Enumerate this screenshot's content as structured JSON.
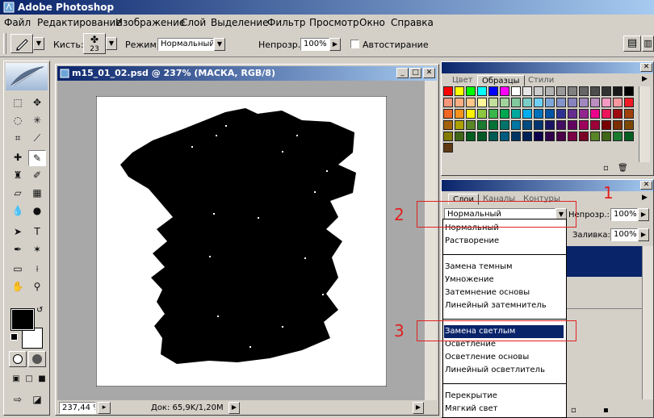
{
  "app": {
    "title": "Adobe Photoshop"
  },
  "menu": [
    "Файл",
    "Редактирование",
    "Изображение",
    "Слой",
    "Выделение",
    "Фильтр",
    "Просмотр",
    "Окно",
    "Справка"
  ],
  "options": {
    "brush_label": "Кисть:",
    "brush_size": "23",
    "mode_label": "Режим:",
    "mode_value": "Нормальный",
    "opacity_label": "Непрозр.:",
    "opacity_value": "100%",
    "autoerase_label": "Автостирание"
  },
  "document": {
    "title": "m15_01_02.psd @ 237% (МАСКА, RGB/8)",
    "zoom": "237,44 %",
    "doc_info": "Док: 65,9K/1,20M"
  },
  "swatches_panel": {
    "tabs": [
      "Цвет",
      "Образцы",
      "Стили"
    ],
    "active_tab": "Образцы",
    "rows": [
      [
        "#ff0000",
        "#ffff00",
        "#00ff00",
        "#00ffff",
        "#0000ff",
        "#ff00ff",
        "#ffffff",
        "#e6e6e6",
        "#cccccc",
        "#b3b3b3",
        "#999999",
        "#808080",
        "#666666",
        "#4d4d4d",
        "#333333",
        "#1a1a1a",
        "#000000"
      ],
      [
        "#f7977a",
        "#f9ad81",
        "#fdc68a",
        "#fff79a",
        "#c4df9b",
        "#a2d39c",
        "#82ca9d",
        "#7bcdc8",
        "#6ecff6",
        "#7ea7d8",
        "#8493ca",
        "#8882be",
        "#a187be",
        "#bc8dbf",
        "#f49ac2",
        "#f6989d",
        "#ed1c24"
      ],
      [
        "#f26522",
        "#f7941d",
        "#fff200",
        "#8dc63f",
        "#39b54a",
        "#00a651",
        "#00a99d",
        "#00aeef",
        "#0072bc",
        "#0054a6",
        "#2e3192",
        "#662d91",
        "#92278f",
        "#ec008c",
        "#ed145b",
        "#9e0b0f",
        "#a0410d"
      ],
      [
        "#a36209",
        "#aba000",
        "#598527",
        "#1a7b30",
        "#007236",
        "#00746b",
        "#0076a3",
        "#004b80",
        "#003471",
        "#1b1464",
        "#440e62",
        "#630460",
        "#9e005d",
        "#9e0039",
        "#790000",
        "#7b2e00",
        "#7d4900"
      ],
      [
        "#827b00",
        "#406618",
        "#005e20",
        "#005826",
        "#005952",
        "#005b7f",
        "#003663",
        "#002157",
        "#0d004c",
        "#32004b",
        "#4b0049",
        "#7b0046",
        "#7a0026",
        "#598527",
        "#406618",
        "#1a7b30",
        "#005e20"
      ],
      [
        "#603913"
      ]
    ]
  },
  "layers_panel": {
    "tabs": [
      "Слои",
      "Каналы",
      "Контуры"
    ],
    "active_tab": "Слои",
    "blend_mode": "Нормальный",
    "opacity_label": "Непрозр.:",
    "opacity_value": "100%",
    "fill_label": "Заливка:",
    "fill_value": "100%"
  },
  "blend_dropdown": {
    "items": [
      {
        "label": "Нормальный",
        "sep_before": false
      },
      {
        "label": "Растворение",
        "sep_before": false
      },
      {
        "label": "Замена темным",
        "sep_before": true
      },
      {
        "label": "Умножение",
        "sep_before": false
      },
      {
        "label": "Затемнение основы",
        "sep_before": false
      },
      {
        "label": "Линейный затемнитель",
        "sep_before": false
      },
      {
        "label": "Замена светлым",
        "sep_before": true,
        "selected": true
      },
      {
        "label": "Осветление",
        "sep_before": false
      },
      {
        "label": "Осветление основы",
        "sep_before": false
      },
      {
        "label": "Линейный осветлитель",
        "sep_before": false
      },
      {
        "label": "Перекрытие",
        "sep_before": true
      },
      {
        "label": "Мягкий свет",
        "sep_before": false
      }
    ]
  },
  "annotations": [
    "1",
    "2",
    "3"
  ],
  "colors": {
    "accent": "#0a246a",
    "annotation": "#e02020",
    "ui": "#d4d0c8"
  }
}
